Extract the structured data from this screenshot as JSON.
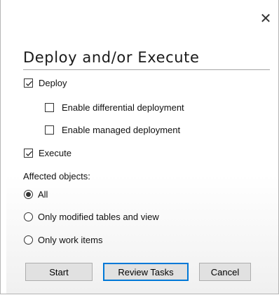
{
  "dialog": {
    "title": "Deploy and/or Execute",
    "close_glyph": "✕",
    "close_icon": "close-icon"
  },
  "options": {
    "deploy": {
      "label": "Deploy",
      "checked": true
    },
    "differential": {
      "label": "Enable differential deployment",
      "checked": false
    },
    "managed": {
      "label": "Enable managed deployment",
      "checked": false
    },
    "execute": {
      "label": "Execute",
      "checked": true
    }
  },
  "affected": {
    "heading": "Affected objects:",
    "choices": [
      {
        "label": "All",
        "selected": true
      },
      {
        "label": "Only modified tables and view",
        "selected": false
      },
      {
        "label": "Only work items",
        "selected": false
      }
    ]
  },
  "buttons": {
    "start": "Start",
    "review": "Review Tasks",
    "cancel": "Cancel"
  },
  "colors": {
    "default_button_border": "#0078d7",
    "button_face": "#e1e1e1"
  }
}
